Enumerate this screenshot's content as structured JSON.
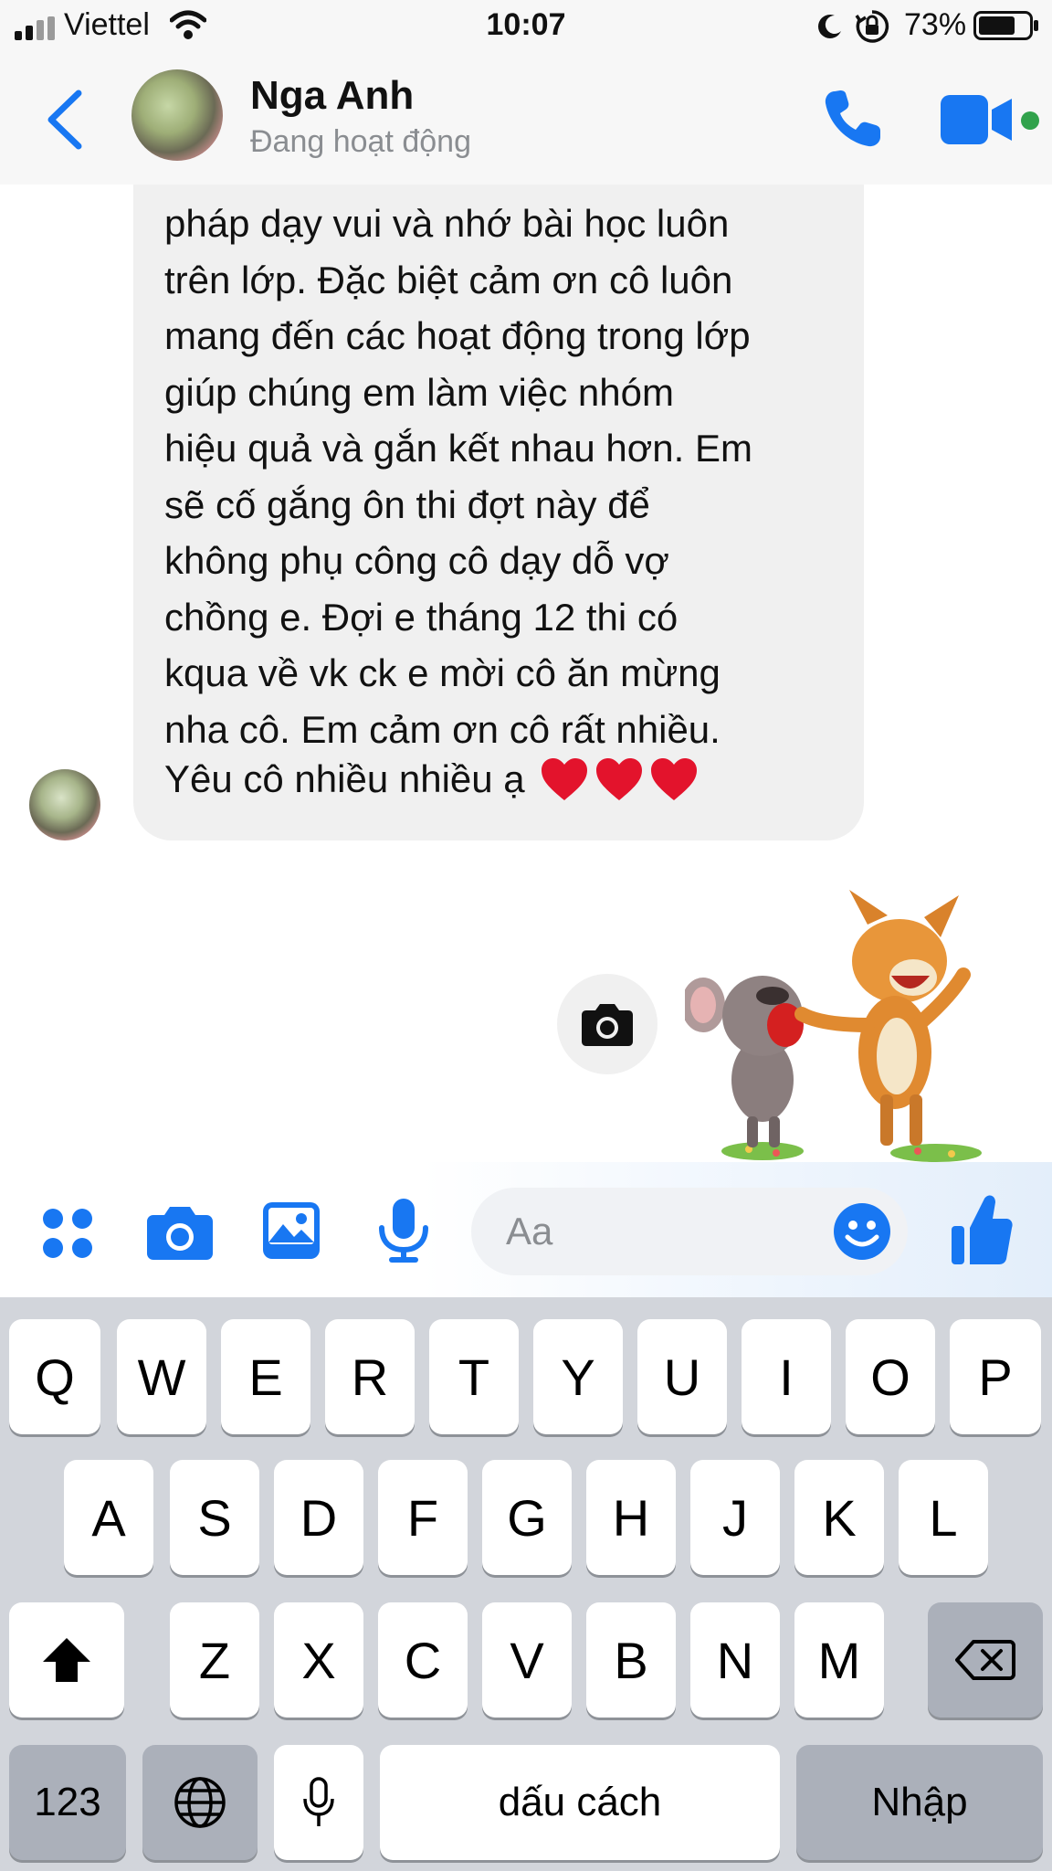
{
  "status_bar": {
    "carrier": "Viettel",
    "time": "10:07",
    "battery": "73%",
    "battery_level": 0.73,
    "icons": [
      "signal-icon",
      "wifi-icon",
      "moon-icon",
      "orientation-lock-icon",
      "battery-icon"
    ]
  },
  "header": {
    "contact_name": "Nga Anh",
    "contact_status": "Đang hoạt động",
    "icons": [
      "back-chevron-icon",
      "phone-icon",
      "video-call-icon"
    ],
    "online_color": "#31a24c"
  },
  "chat": {
    "message_lines": [
      "pháp dạy vui và nhớ bài học luôn",
      "trên lớp. Đặc biệt cảm ơn cô luôn",
      "mang đến các hoạt động trong lớp",
      "giúp chúng em làm việc nhóm",
      "hiệu quả và gắn kết nhau hơn. Em",
      "sẽ cố gắng ôn thi đợt này để",
      "không phụ công cô dạy dỗ vợ",
      "chồng e. Đợi e tháng 12 thi có",
      "kqua về vk ck e mời cô ăn mừng",
      "nha cô. Em cảm ơn cô rất nhiều."
    ],
    "last_message": "Yêu cô nhiều nhiều ạ",
    "hearts": 3,
    "sticker": "dancing-animals-sticker"
  },
  "composer": {
    "placeholder": "Aa",
    "icons": [
      "apps-icon",
      "camera-icon",
      "photo-icon",
      "microphone-icon",
      "emoji-icon",
      "like-icon"
    ],
    "accent_color": "#1877f2"
  },
  "keyboard": {
    "row1": [
      "Q",
      "W",
      "E",
      "R",
      "T",
      "Y",
      "U",
      "I",
      "O",
      "P"
    ],
    "row2": [
      "A",
      "S",
      "D",
      "F",
      "G",
      "H",
      "J",
      "K",
      "L"
    ],
    "row3": [
      "Z",
      "X",
      "C",
      "V",
      "B",
      "N",
      "M"
    ],
    "num_key": "123",
    "space_key": "dấu cách",
    "return_key": "Nhập",
    "icons": [
      "shift-icon",
      "backspace-icon",
      "globe-icon",
      "dictation-mic-icon"
    ]
  }
}
